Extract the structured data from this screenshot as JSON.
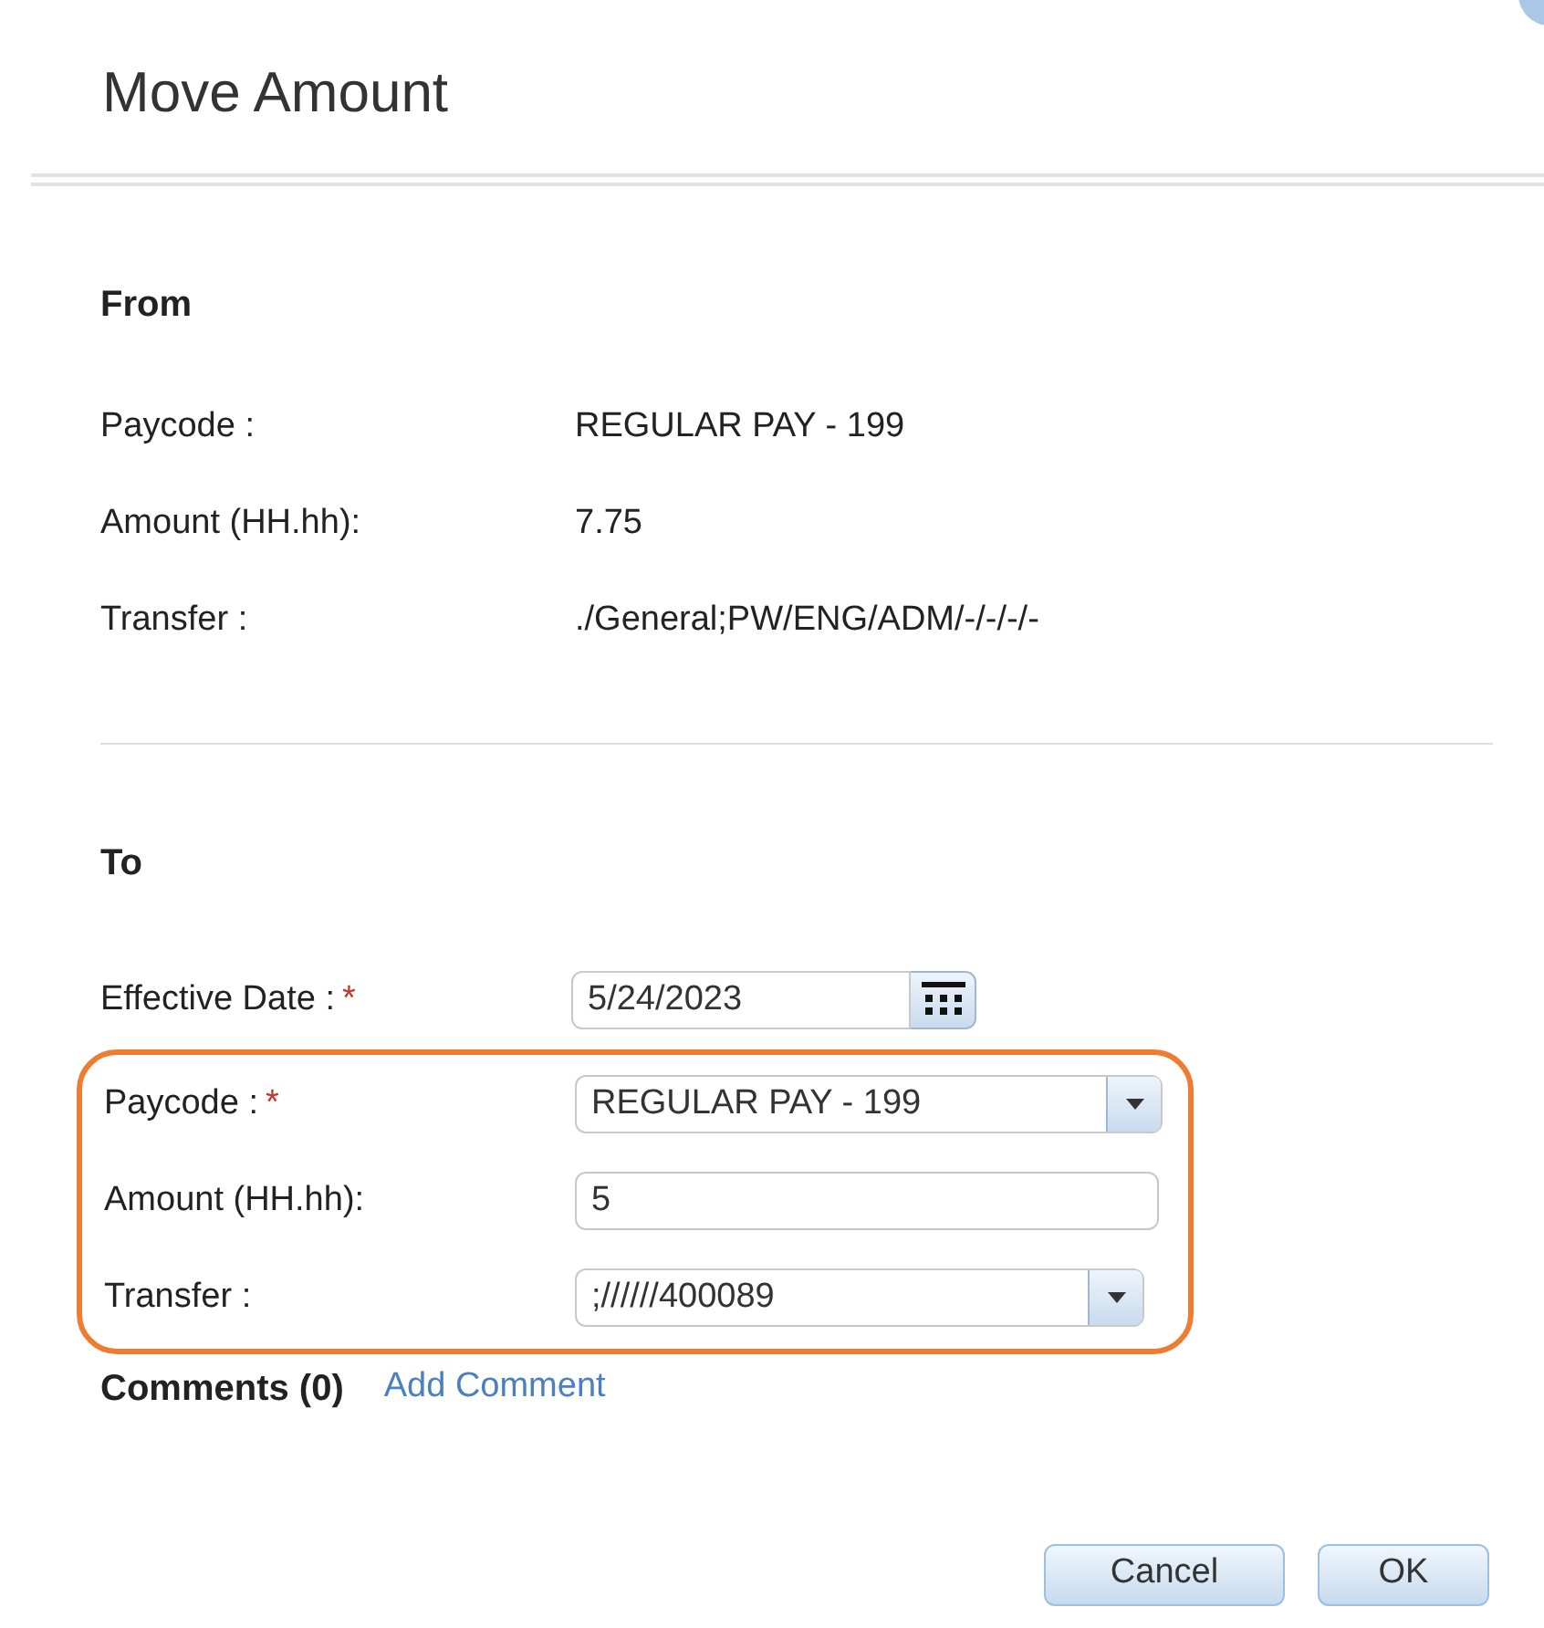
{
  "window": {
    "title": "Move Amount"
  },
  "from": {
    "heading": "From",
    "rows": [
      {
        "label": "Paycode :",
        "value": "REGULAR PAY - 199"
      },
      {
        "label": "Amount (HH.hh):",
        "value": "7.75"
      },
      {
        "label": "Transfer :",
        "value": "./General;PW/ENG/ADM/-/-/-/-"
      }
    ]
  },
  "to": {
    "heading": "To",
    "required_mark": "*",
    "fields": [
      {
        "kind": "date",
        "label": "Effective Date :",
        "required": true,
        "value": "5/24/2023",
        "highlighted": false
      },
      {
        "kind": "select",
        "label": "Paycode :",
        "required": true,
        "value": "REGULAR PAY - 199",
        "highlighted": true
      },
      {
        "kind": "text",
        "label": "Amount (HH.hh):",
        "required": false,
        "value": "5",
        "highlighted": true
      },
      {
        "kind": "select",
        "label": "Transfer :",
        "required": false,
        "value": ";//////400089",
        "highlighted": true
      }
    ]
  },
  "comments": {
    "label": "Comments (0)",
    "link": "Add Comment"
  },
  "buttons": [
    "Cancel",
    "OK"
  ]
}
